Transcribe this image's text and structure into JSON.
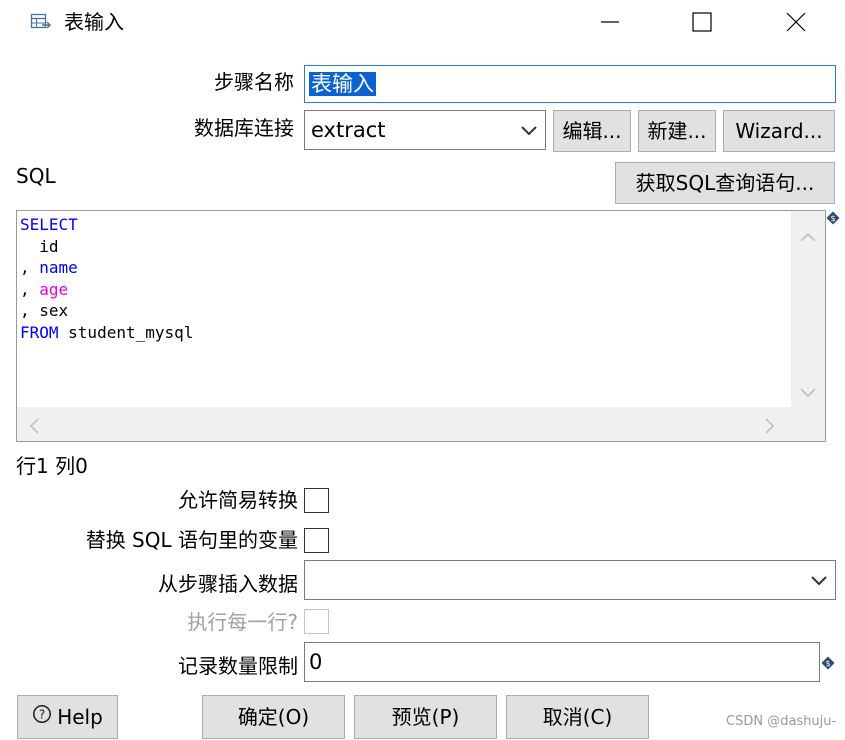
{
  "window": {
    "title": "表输入",
    "icon": "table-input-icon"
  },
  "form": {
    "step_name_label": "步骤名称",
    "step_name_value": "表输入",
    "db_conn_label": "数据库连接",
    "db_conn_value": "extract",
    "edit_button": "编辑...",
    "new_button": "新建...",
    "wizard_button": "Wizard...",
    "sql_label": "SQL",
    "get_sql_button": "获取SQL查询语句...",
    "cursor_status": "行1 列0",
    "allow_lazy_label": "允许简易转换",
    "replace_vars_label": "替换 SQL 语句里的变量",
    "insert_from_step_label": "从步骤插入数据",
    "insert_from_step_value": "",
    "exec_each_row_label": "执行每一行?",
    "limit_label": "记录数量限制",
    "limit_value": "0"
  },
  "sql": {
    "line1": "SELECT",
    "line2": "  id",
    "line3_prefix": ", ",
    "line3_name": "name",
    "line4_prefix": ", ",
    "line4_name": "age",
    "line5": ", sex",
    "line6_kw": "FROM",
    "line6_rest": " student_mysql"
  },
  "footer": {
    "help_button": "Help",
    "ok_button": "确定(O)",
    "preview_button": "预览(P)",
    "cancel_button": "取消(C)",
    "watermark": "CSDN @dashuju-"
  },
  "colors": {
    "keyword": "#0000ff",
    "function": "#e600e6",
    "selection": "#0a64d0",
    "focus_border": "#2b7ad4"
  }
}
